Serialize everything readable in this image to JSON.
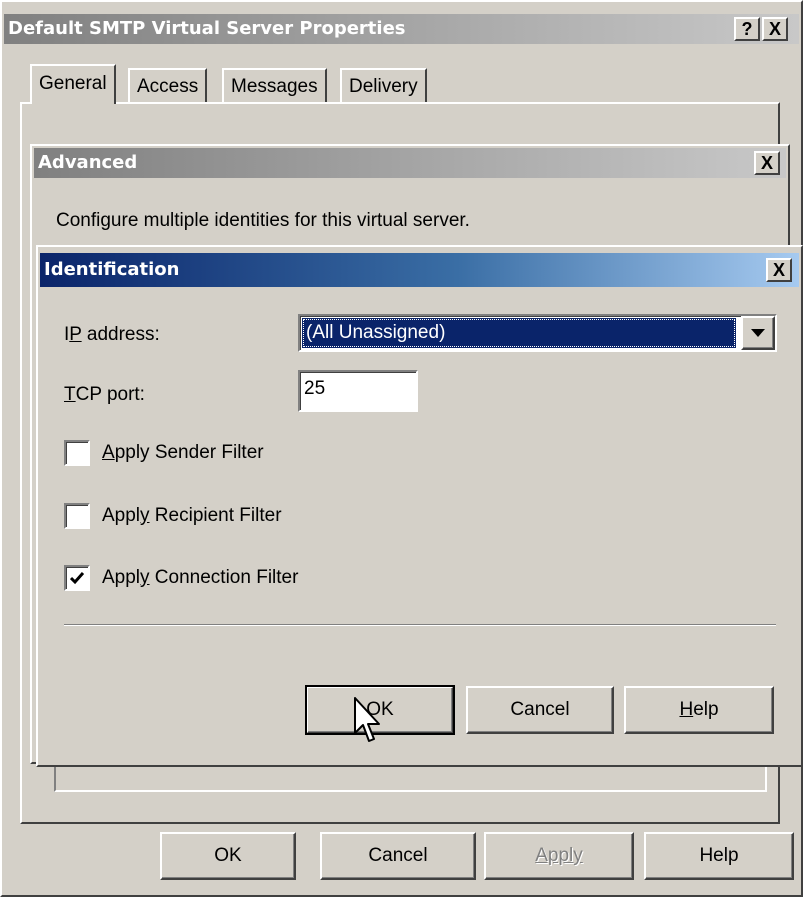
{
  "outer_dialog": {
    "title": "Default SMTP Virtual Server Properties",
    "help_caption": "?",
    "close_caption": "X",
    "tabs": [
      {
        "label": "General"
      },
      {
        "label": "Access"
      },
      {
        "label": "Messages"
      },
      {
        "label": "Delivery"
      }
    ],
    "buttons": {
      "ok": "OK",
      "cancel": "Cancel",
      "apply": "Apply",
      "help": "Help"
    }
  },
  "advanced_dialog": {
    "title": "Advanced",
    "close_caption": "X",
    "description": "Configure multiple identities for this virtual server."
  },
  "identification_dialog": {
    "title": "Identification",
    "close_caption": "X",
    "ip_address": {
      "label_pre": "I",
      "label_accel": "P",
      "label_post": " address:",
      "value": "(All Unassigned)"
    },
    "tcp_port": {
      "label_accel": "T",
      "label_post": "CP port:",
      "value": "25"
    },
    "filters": [
      {
        "pre": "",
        "accel": "A",
        "post": "pply Sender Filter",
        "checked": false
      },
      {
        "pre": "Appl",
        "accel": "y",
        "post": " Recipient Filter",
        "checked": false
      },
      {
        "pre": "Appl",
        "accel": "y",
        "post": " Connection Filter",
        "checked": true
      }
    ],
    "buttons": {
      "ok": "OK",
      "cancel": "Cancel",
      "help_accel": "H",
      "help_post": "elp"
    }
  }
}
